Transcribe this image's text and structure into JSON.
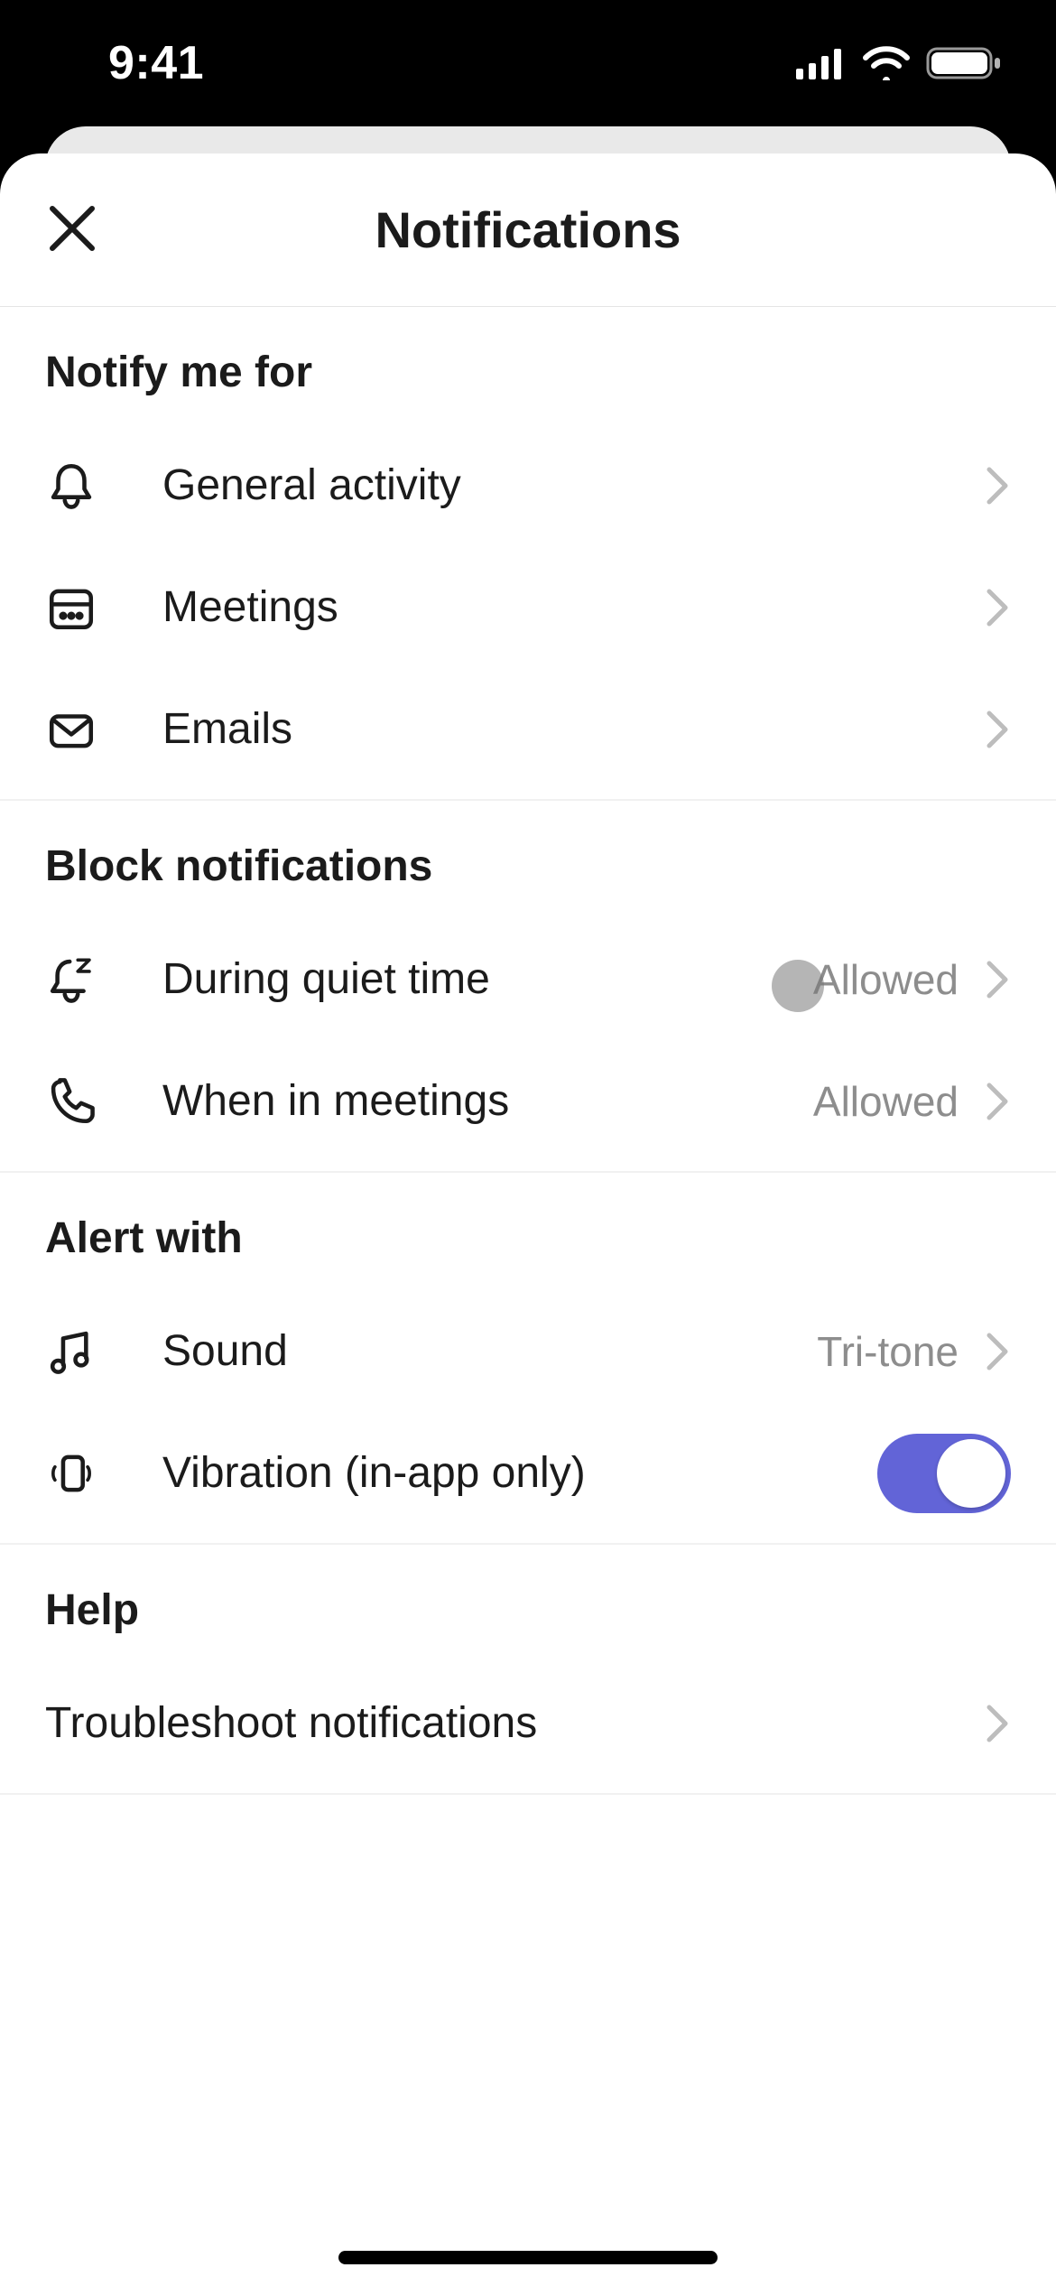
{
  "status_bar": {
    "time": "9:41"
  },
  "page": {
    "title": "Notifications"
  },
  "sections": {
    "notify": {
      "title": "Notify me for",
      "rows": {
        "general": {
          "label": "General activity"
        },
        "meetings": {
          "label": "Meetings"
        },
        "emails": {
          "label": "Emails"
        }
      }
    },
    "block": {
      "title": "Block notifications",
      "rows": {
        "quiet": {
          "label": "During quiet time",
          "value": "Allowed"
        },
        "meeting": {
          "label": "When in meetings",
          "value": "Allowed"
        }
      }
    },
    "alert": {
      "title": "Alert with",
      "rows": {
        "sound": {
          "label": "Sound",
          "value": "Tri-tone"
        },
        "vibration": {
          "label": "Vibration (in-app only)",
          "toggle_on": true
        }
      }
    },
    "help": {
      "title": "Help",
      "rows": {
        "troubleshoot": {
          "label": "Troubleshoot notifications"
        }
      }
    }
  },
  "colors": {
    "accent": "#6264d7"
  }
}
